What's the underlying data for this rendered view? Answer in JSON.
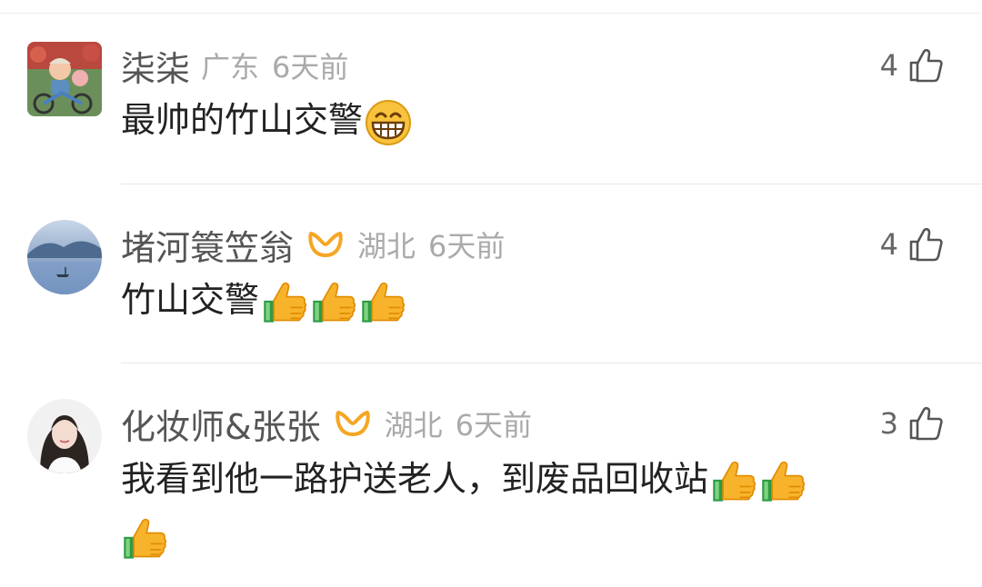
{
  "comments": [
    {
      "username": "柒柒",
      "location": "广东",
      "time": "6天前",
      "likes": "4",
      "text": "最帅的竹山交警",
      "emojis": [
        "grin-emoji"
      ]
    },
    {
      "username": "堵河簑笠翁",
      "location": "湖北",
      "time": "6天前",
      "likes": "4",
      "text": "竹山交警",
      "emojis": [
        "thumbs-up-emoji",
        "thumbs-up-emoji",
        "thumbs-up-emoji"
      ]
    },
    {
      "username": "化妆师&张张",
      "location": "湖北",
      "time": "6天前",
      "likes": "3",
      "text_line1": "我看到他一路护送老人，到废品回收站",
      "emojis": [
        "thumbs-up-emoji",
        "thumbs-up-emoji",
        "thumbs-up-emoji"
      ]
    }
  ],
  "colors": {
    "username": "#555555",
    "meta": "#aaaaaa",
    "text": "#222222",
    "badge": "#f5a623",
    "divider": "#e8e8e8"
  }
}
